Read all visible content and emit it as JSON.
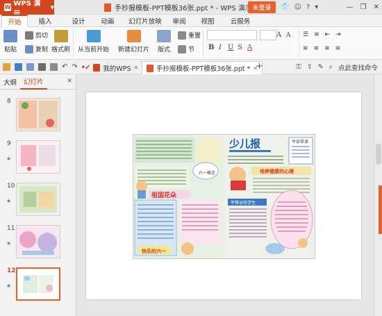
{
  "titlebar": {
    "app_label": "WPS 演示",
    "doc_title": "手抄报模板-PPT模板36张.ppt * - WPS 演示",
    "login_label": "未登录"
  },
  "menu": {
    "tabs": [
      "开始",
      "插入",
      "设计",
      "动画",
      "幻灯片放映",
      "审阅",
      "视图",
      "云服务"
    ],
    "active": "开始"
  },
  "ribbon": {
    "paste": "粘贴",
    "cut": "剪切",
    "copy": "复制",
    "format_painter": "格式刷",
    "from_current": "从当前开始",
    "new_slide": "新建幻灯片",
    "layout": "版式",
    "section": "节",
    "reset": "重置"
  },
  "tabs": {
    "home": "我的WPS",
    "document": "手抄报模板-PPT模板36张.ppt *",
    "right_action": "点此查找命令"
  },
  "leftpanel": {
    "tab_outline": "大纲",
    "tab_slides": "幻灯片",
    "slides": [
      {
        "num": "8"
      },
      {
        "num": "9"
      },
      {
        "num": "10"
      },
      {
        "num": "11"
      },
      {
        "num": "12"
      }
    ],
    "current": "12"
  },
  "poster": {
    "left_title": "祖国花朵",
    "left_sub": "六一格言",
    "left_footer": "快乐的六一",
    "right_title": "少儿报",
    "right_heading1": "培养健康的心理",
    "right_heading2": "平等对待学生",
    "right_heading3": "今日导读"
  },
  "colors": {
    "accent": "#d2461e",
    "accent_light": "#e8602c"
  }
}
